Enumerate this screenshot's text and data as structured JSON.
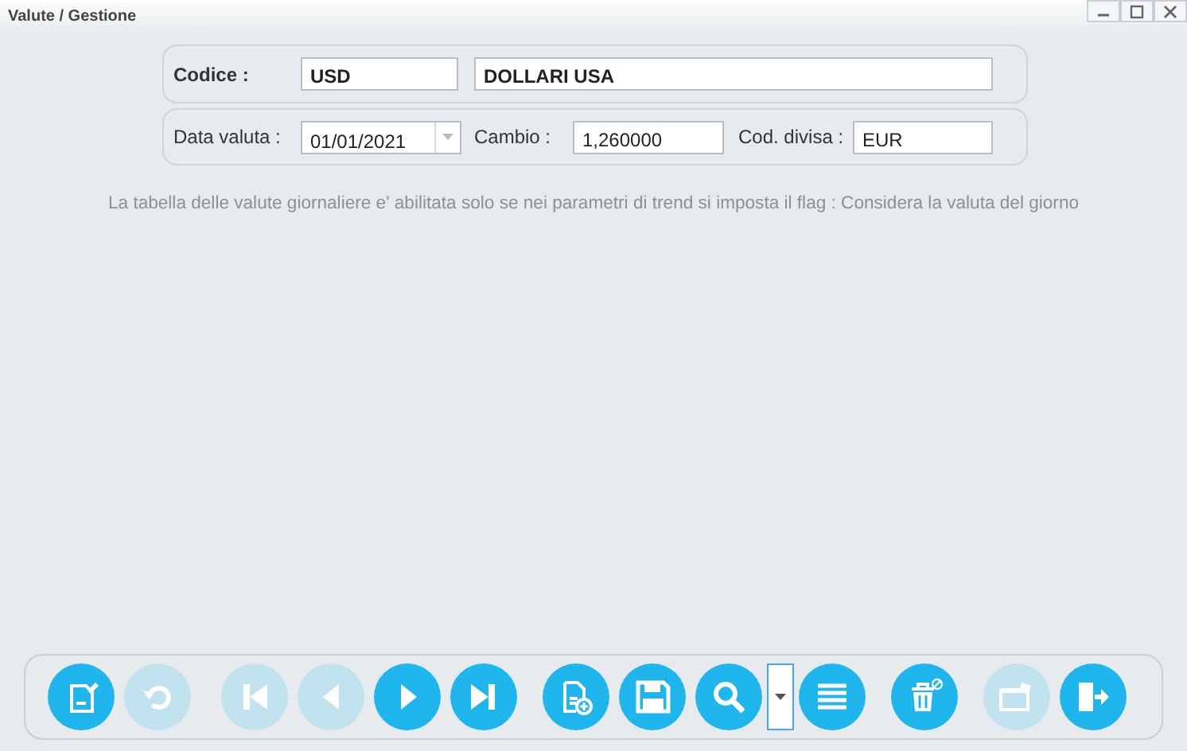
{
  "window": {
    "title": "Valute / Gestione"
  },
  "codice": {
    "label": "Codice :",
    "code": "USD",
    "description": "DOLLARI USA"
  },
  "details": {
    "date_label": "Data valuta :",
    "date": "01/01/2021",
    "rate_label": "Cambio :",
    "rate": "1,260000",
    "currency_label": "Cod. divisa :",
    "currency": "EUR"
  },
  "note": "La tabella delle valute giornaliere e' abilitata solo se nei parametri di trend si imposta il flag : Considera la valuta del giorno",
  "toolbar": [
    [
      {
        "kind": "edit",
        "disabled": false
      },
      {
        "kind": "undo",
        "disabled": true
      }
    ],
    [
      {
        "kind": "first",
        "disabled": true
      },
      {
        "kind": "prev",
        "disabled": true
      },
      {
        "kind": "next",
        "disabled": false
      },
      {
        "kind": "last",
        "disabled": false
      }
    ],
    [
      {
        "kind": "new",
        "disabled": false
      },
      {
        "kind": "save",
        "disabled": false
      },
      {
        "kind": "search",
        "disabled": false
      },
      {
        "kind": "dropdown"
      },
      {
        "kind": "list",
        "disabled": false
      }
    ],
    [
      {
        "kind": "delete",
        "disabled": false
      }
    ],
    [
      {
        "kind": "folder",
        "disabled": true
      },
      {
        "kind": "exit",
        "disabled": false
      }
    ]
  ]
}
